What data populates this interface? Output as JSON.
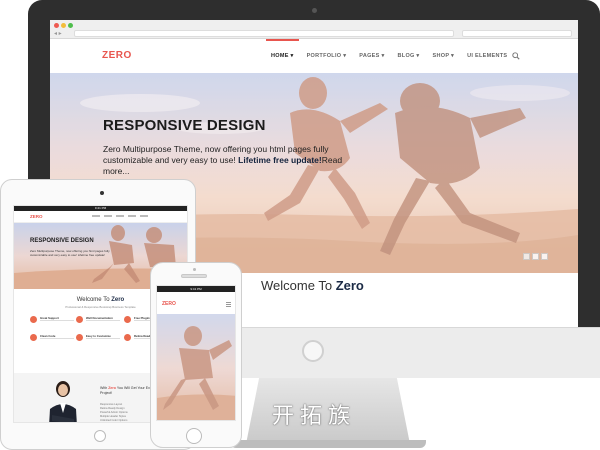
{
  "desktop": {
    "brand": "ZERO",
    "menu": [
      {
        "label": "HOME ▾",
        "active": true
      },
      {
        "label": "PORTFOLIO ▾",
        "active": false
      },
      {
        "label": "PAGES ▾",
        "active": false
      },
      {
        "label": "BLOG ▾",
        "active": false
      },
      {
        "label": "SHOP ▾",
        "active": false
      },
      {
        "label": "UI ELEMENTS",
        "active": false
      }
    ],
    "hero": {
      "title": "RESPONSIVE DESIGN",
      "text_plain": "Zero Multipurpose Theme, now offering you html pages fully customizable and very easy to use!",
      "text_bold": "Lifetime free update!",
      "read_more": "Read more..."
    },
    "welcome": {
      "prefix": "Welcome To",
      "name": "Zero"
    }
  },
  "tablet": {
    "status": "9:41 PM",
    "brand": "ZERO",
    "hero_title": "RESPONSIVE DESIGN",
    "hero_text": "Zero Multipurpose Theme, now offering you html pages fully customizable and very easy to use! Lifetime free update!",
    "welcome_prefix": "Welcome To",
    "welcome_name": "Zero",
    "welcome_sub": "Professional & Responsive Bootstrap Business Template",
    "features": [
      "Great Support",
      "Well Documentation",
      "Free Plugins",
      "Clean Code",
      "Easy to Customize",
      "Retina Ready"
    ],
    "lower_title_prefix": "With",
    "lower_title_brand": "Zero",
    "lower_title_rest": "You Will Get Your Exclusive Project!",
    "lower_list": [
      "Responsive Layout",
      "Retina Ready Design",
      "Powerful Admin Options",
      "Multiple Header Styles",
      "Unlimited Color Options"
    ]
  },
  "phone": {
    "status": "9:41 PM",
    "brand": "ZERO"
  },
  "watermark": "开拓族",
  "colors": {
    "accent": "#e8554e",
    "frame": "#2e2e2e",
    "heading": "#1b2a45"
  },
  "icons": [
    "search-icon",
    "menu-icon"
  ]
}
